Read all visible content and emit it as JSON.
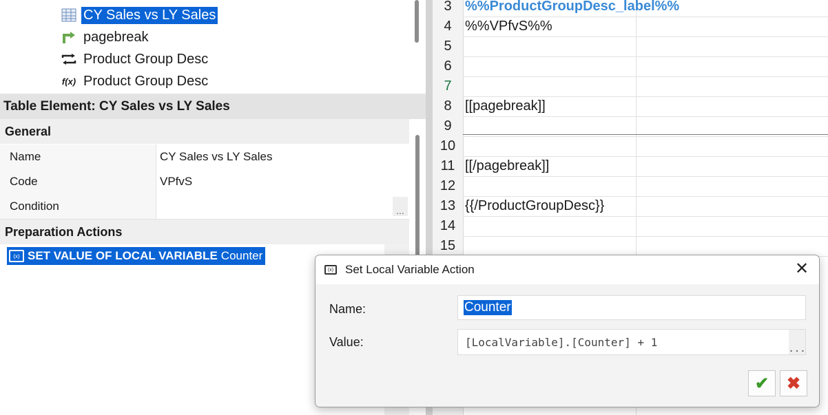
{
  "tree": {
    "items": [
      {
        "icon": "table-icon",
        "label": "CY Sales vs LY Sales",
        "selected": true
      },
      {
        "icon": "pagebreak-icon",
        "label": "pagebreak",
        "selected": false
      },
      {
        "icon": "loop-icon",
        "label": "Product Group Desc",
        "selected": false
      },
      {
        "icon": "function-icon",
        "label": "Product Group Desc",
        "selected": false
      }
    ],
    "function_glyph": "f(x)"
  },
  "properties": {
    "title": "Table Element: CY Sales vs LY Sales",
    "general_header": "General",
    "rows": [
      {
        "key": "Name",
        "value": "CY Sales vs LY Sales"
      },
      {
        "key": "Code",
        "value": "VPfvS"
      },
      {
        "key": "Condition",
        "value": ""
      }
    ],
    "ellipsis": "...",
    "prep_header": "Preparation Actions",
    "action": {
      "kind": "SET VALUE OF LOCAL VARIABLE",
      "target": "Counter"
    }
  },
  "sheet": {
    "rows": [
      {
        "num": "3",
        "text": "%%ProductGroupDesc_label%%",
        "label": true
      },
      {
        "num": "4",
        "text": "%%VPfvS%%"
      },
      {
        "num": "5",
        "text": ""
      },
      {
        "num": "6",
        "text": ""
      },
      {
        "num": "7",
        "text": "",
        "active": true
      },
      {
        "num": "8",
        "text": "[[pagebreak]]"
      },
      {
        "num": "9",
        "text": ""
      },
      {
        "num": "10",
        "text": ""
      },
      {
        "num": "11",
        "text": "[[/pagebreak]]"
      },
      {
        "num": "12",
        "text": ""
      },
      {
        "num": "13",
        "text": "{{/ProductGroupDesc}}"
      },
      {
        "num": "14",
        "text": ""
      },
      {
        "num": "15",
        "text": ""
      }
    ]
  },
  "dialog": {
    "title": "Set Local Variable Action",
    "name_label": "Name:",
    "name_value": "Counter",
    "value_label": "Value:",
    "value_value": "[LocalVariable].[Counter] + 1",
    "ellipsis": "...",
    "close_glyph": "✕",
    "ok_glyph": "✔",
    "cancel_glyph": "✖"
  },
  "colors": {
    "selection": "#0a64d6",
    "label_text": "#3a8ad6",
    "ok": "#3c9a2a",
    "cancel": "#d23b2b"
  }
}
